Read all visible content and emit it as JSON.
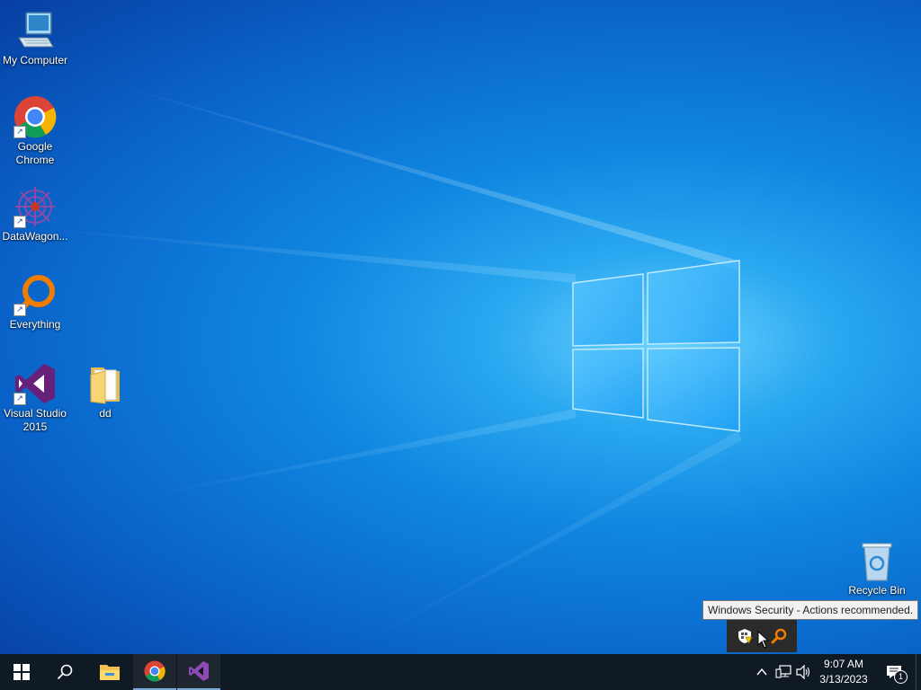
{
  "desktop": {
    "icons": [
      {
        "label": "My Computer",
        "icon": "computer-icon"
      },
      {
        "label": "Google Chrome",
        "icon": "chrome-icon",
        "shortcut": true
      },
      {
        "label": "DataWagon...",
        "icon": "datawagon-icon",
        "shortcut": true
      },
      {
        "label": "Everything",
        "icon": "everything-search-icon",
        "shortcut": true
      },
      {
        "label": "Visual Studio 2015",
        "icon": "visual-studio-icon",
        "shortcut": true
      },
      {
        "label": "dd",
        "icon": "folder-icon"
      },
      {
        "label": "Recycle Bin",
        "icon": "recycle-bin-icon"
      }
    ]
  },
  "tooltip": {
    "text": "Windows Security - Actions recommended."
  },
  "tray_flyout": {
    "icons": [
      "windows-security-warning-icon",
      "everything-tray-icon"
    ]
  },
  "taskbar": {
    "pinned": [
      "start-icon",
      "search-icon",
      "file-explorer-icon",
      "chrome-icon",
      "visual-studio-icon"
    ],
    "clock": {
      "time": "9:07 AM",
      "date": "3/13/2023"
    },
    "notifications": {
      "count": "1"
    },
    "tray": [
      "show-hidden-icons-chevron",
      "network-icon",
      "volume-icon"
    ]
  },
  "colors": {
    "taskbar_bg": "#101a24",
    "desktop_accent": "#0f86e0",
    "visual_studio": "#68217a",
    "everything_orange": "#f07c00"
  }
}
